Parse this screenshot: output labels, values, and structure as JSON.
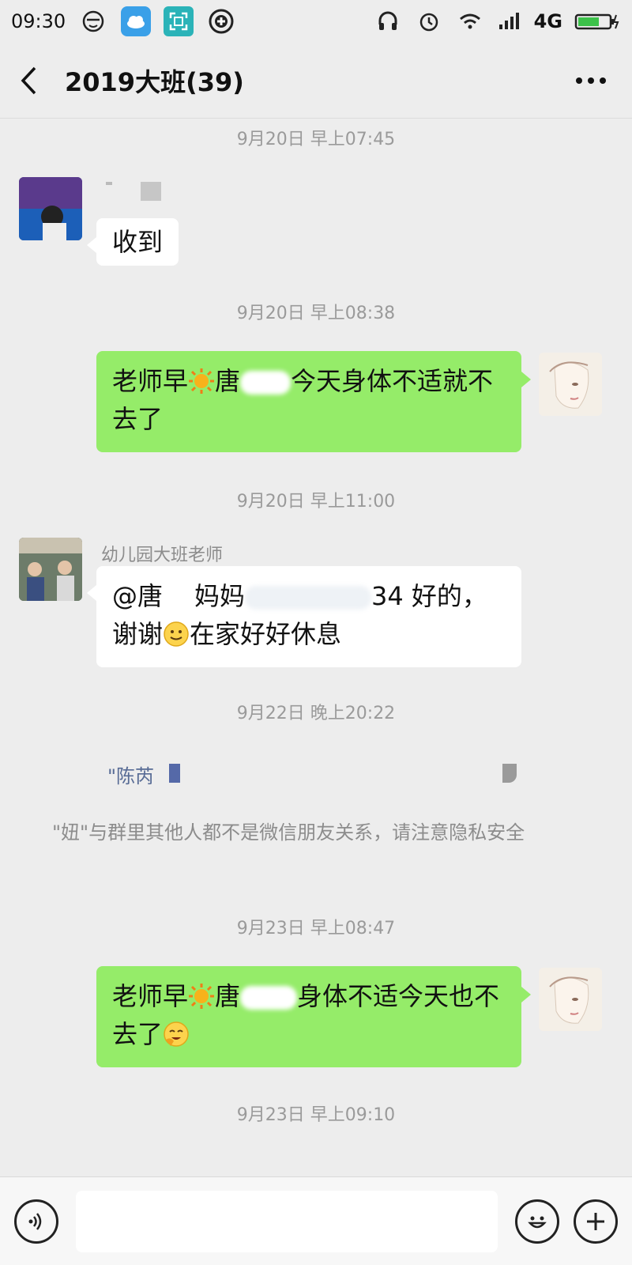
{
  "status_bar": {
    "time": "09:30",
    "network": "4G",
    "icons": [
      "face-icon",
      "weather-icon",
      "scan-icon",
      "plus-circle-icon",
      "headphone-icon",
      "alarm-icon",
      "wifi-icon",
      "signal-icon",
      "battery-icon"
    ]
  },
  "header": {
    "title": "2019大班(39)",
    "back_icon": "chevron-left-icon",
    "more_icon": "more-dots-icon"
  },
  "messages": {
    "t1": "9月20日 早上07:45",
    "m1_text": "收到",
    "t2": "9月20日 早上08:38",
    "m2_part1": "老师早",
    "m2_part2": "唐",
    "m2_part3": "今天身体不适就不去了",
    "t3": "9月20日 早上11:00",
    "m3_sender": "幼儿园大班老师",
    "m3_part1": "@唐",
    "m3_part2": "妈妈",
    "m3_part3": "34 好的，谢谢",
    "m3_part4": "在家好好休息",
    "t4": "9月22日 晚上20:22",
    "quoted_name": "\"陈芮",
    "system_notice": "\"妞\"与群里其他人都不是微信朋友关系，请注意隐私安全",
    "t5": "9月23日 早上08:47",
    "m5_part1": "老师早",
    "m5_part2": "唐",
    "m5_part3": "身体不适今天也不去了",
    "t6": "9月23日 早上09:10"
  },
  "input_bar": {
    "placeholder": "",
    "voice_icon": "voice-icon",
    "emoji_icon": "emoji-icon",
    "plus_icon": "plus-icon"
  },
  "colors": {
    "background": "#ededed",
    "outgoing_bubble": "#95ec69",
    "incoming_bubble": "#ffffff",
    "timestamp": "#9a9a9a"
  }
}
